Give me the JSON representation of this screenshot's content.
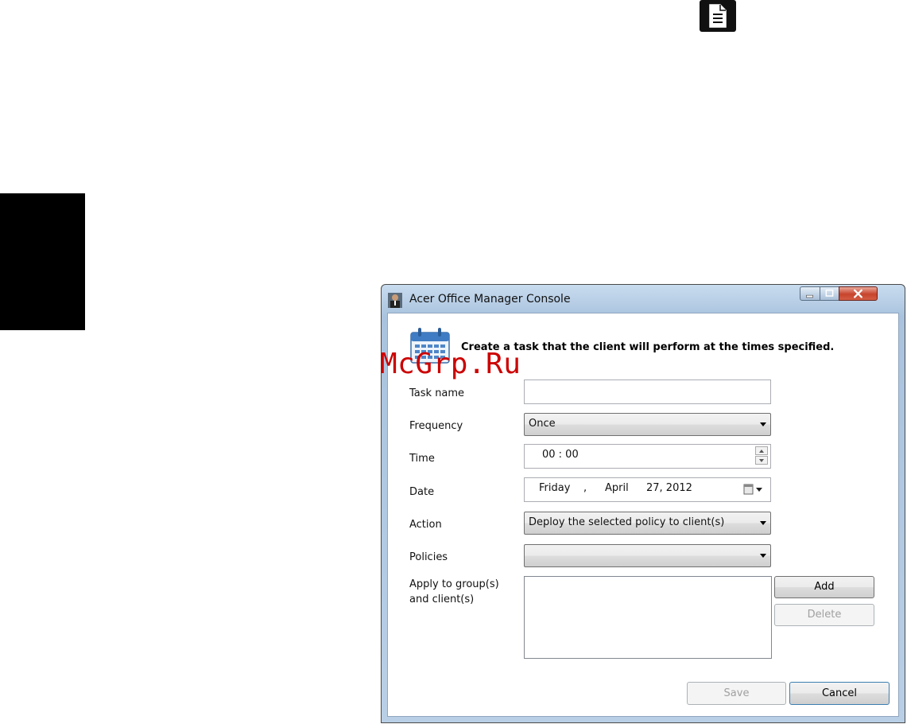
{
  "window": {
    "title": "Acer Office Manager Console",
    "header_text": "Create a task that the client will perform at the times specified."
  },
  "watermark": "McGrp.Ru",
  "form": {
    "task_name": {
      "label": "Task name",
      "value": ""
    },
    "frequency": {
      "label": "Frequency",
      "value": "Once"
    },
    "time": {
      "label": "Time",
      "value": "00 : 00"
    },
    "date": {
      "label": "Date",
      "weekday": "Friday",
      "separator": ",",
      "month": "April",
      "day_year": "27, 2012"
    },
    "action": {
      "label": "Action",
      "value": "Deploy the selected policy to client(s)"
    },
    "policies": {
      "label": "Policies",
      "value": ""
    },
    "apply_to": {
      "label_line1": "Apply to group(s)",
      "label_line2": "and client(s)",
      "items": []
    }
  },
  "buttons": {
    "add": "Add",
    "delete": "Delete",
    "save": "Save",
    "cancel": "Cancel"
  },
  "icons": {
    "page_corner": "document-icon",
    "app": "app-icon",
    "header": "calendar-icon"
  }
}
